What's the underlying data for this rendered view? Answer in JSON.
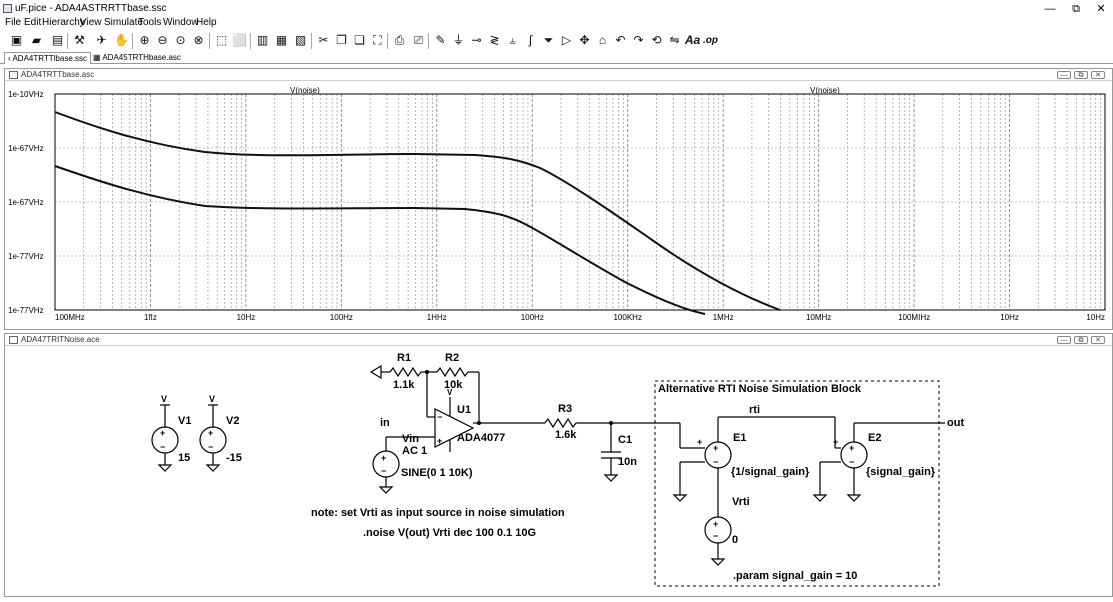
{
  "window": {
    "title": "uF.pice - ADA4ASTRRTTbase.ssc",
    "minimize": "—",
    "restore": "⧉",
    "close": "✕"
  },
  "menu": [
    "File",
    "Edit",
    "Hierarchy",
    "View",
    "Simulate",
    "Tools",
    "Window",
    "Help"
  ],
  "tabs": [
    {
      "label": "ADA4TRTTlbase.ssc"
    },
    {
      "label": "ADA45TRTHbase.asc"
    }
  ],
  "plot_pane": {
    "title": "ADA4TRTTbase.asc",
    "buttons": [
      "—",
      "⧉",
      "✕"
    ]
  },
  "schem_pane": {
    "title": "ADA47TRITNoise.ace",
    "buttons": [
      "—",
      "⧉",
      "✕"
    ]
  },
  "chart_data": {
    "type": "line",
    "trace_labels": [
      "V(noise)",
      "V(noise)"
    ],
    "x_ticks": [
      "100MHz",
      "1fIz",
      "10Hz",
      "100Hz",
      "1HHz",
      "100Hz",
      "100KHz",
      "1MHz",
      "10MHz",
      "100MIHz",
      "10Hz",
      "10Hz"
    ],
    "y_ticks": [
      "1e-10VHz",
      "1e-67VHz",
      "1e-67VHz",
      "1e-77VHz",
      "1e-77VHz"
    ],
    "x_scale": "log",
    "grid": true
  },
  "schematic": {
    "v1": {
      "name": "V1",
      "value": "15"
    },
    "v2": {
      "name": "V2",
      "value": "-15"
    },
    "r1": {
      "name": "R1",
      "value": "1.1k"
    },
    "r2": {
      "name": "R2",
      "value": "10k"
    },
    "u1": {
      "name": "U1",
      "model": "ADA4077"
    },
    "r3": {
      "name": "R3",
      "value": "1.6k"
    },
    "c1": {
      "name": "C1",
      "value": "10n"
    },
    "vin": {
      "name": "Vin",
      "ac": "AC 1",
      "sine": "SINE(0 1 10K)"
    },
    "in_label": "in",
    "block_title": "Alternative RTI Noise Simulation Block",
    "rti_label": "rti",
    "out_label": "out",
    "e1": {
      "name": "E1",
      "value": "{1/signal_gain}"
    },
    "e2": {
      "name": "E2",
      "value": "{signal_gain}"
    },
    "vrti": {
      "name": "Vrti",
      "value": "0"
    },
    "param": ".param signal_gain = 10",
    "note": "note: set Vrti as input source in noise simulation",
    "noise_cmd": ".noise V(out) Vrti dec 100 0.1 10G"
  },
  "colors": {
    "trace": "#111111",
    "grid": "#888888",
    "wire": "#000000"
  }
}
